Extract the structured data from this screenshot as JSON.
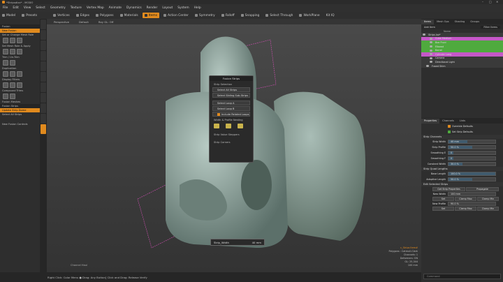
{
  "window": {
    "title": "*Stripsdlxs* - MODO",
    "min": "–",
    "max": "□",
    "close": "✕"
  },
  "menu": [
    "File",
    "Edit",
    "View",
    "Select",
    "Geometry",
    "Texture",
    "Vertex Map",
    "Animate",
    "Dynamics",
    "Render",
    "Layout",
    "System",
    "Help"
  ],
  "toolbar": {
    "model": "Model",
    "presets": "Presets",
    "vertices": "Vertices",
    "edges": "Edges",
    "polygons": "Polygons",
    "materials": "Materials",
    "items": "Items",
    "action_center": "Action Center",
    "symmetry": "Symmetry",
    "falloff": "Falloff",
    "snapping": "Snapping",
    "select_through": "Select Through",
    "workplane": "WorkPlane",
    "kit": "Kit IQ"
  },
  "left": {
    "fusion": "Fusion",
    "new_fusion": "New Fusion",
    "set_mesh_role": "Set or Change Mesh Role",
    "set_mesh_role_apply": "Set Mesh Role & Apply",
    "trim": "Trim / Un-Trim",
    "duplication": "Duplication",
    "display_filters": "Display Filters",
    "compound_trims": "Compound Trims",
    "fusion_meshes": "Fusion Meshes",
    "fusion_strips": "Fusion Strips",
    "update_strip": "Update Strip Dome",
    "select_all_strips": "Select All Strips",
    "new_fusion_controls": "New Fusion Controls"
  },
  "viewport": {
    "view": "Perspective",
    "shading": "Default",
    "ray_gl": "Ray GL: Off",
    "channel_haul": "Channel Haul"
  },
  "popup": {
    "title": "Fusion Strips",
    "strip_selection": "Strip Selection",
    "select_all": "Select All Strips",
    "select_sliding": "Select Sliding Sub-Strips",
    "select_loop_a": "Select Loop A",
    "select_loop_b": "Select Loop B",
    "include_loops": "Include Related Loops",
    "width_profile": "Width & Profile Nesting",
    "strip_value": "Strip Value Steppers",
    "strip_corners": "Strip Corners"
  },
  "strip_width": {
    "label": "Strip_Width",
    "value": "40 mm"
  },
  "vpinfo": [
    "c_Strips Item#",
    "Polygons : Catmull-Clark",
    "Channels: 1",
    "Deformers: ON",
    "GL: 25,344",
    "100 mm"
  ],
  "status": "Right Click: Color Menu  ●  Drag: Any Button] Click and Drag: Release Verify",
  "right": {
    "tabs": [
      "Items",
      "Mesh Ops",
      "Shading",
      "Groups"
    ],
    "add_item": "Add Item",
    "filter": "Filter Items",
    "name_hdr": "Name",
    "items": [
      {
        "name": "Strips.lxo*",
        "color": "#3a3a3a",
        "indent": 0
      },
      {
        "name": "Cube Medium",
        "color": "#c558c8",
        "indent": 2
      },
      {
        "name": "Box Fluid",
        "color": "#4faa3e",
        "indent": 2
      },
      {
        "name": "Elbowd",
        "color": "#4faa3e",
        "indent": 2
      },
      {
        "name": "Barrel",
        "color": "#4faa3e",
        "indent": 2
      },
      {
        "name": "Cylinder Long",
        "color": "#c558c8",
        "indent": 2
      },
      {
        "name": "Camera",
        "color": "#3a3a3a",
        "indent": 2
      },
      {
        "name": "Directional Light",
        "color": "#3a3a3a",
        "indent": 2
      },
      {
        "name": "Fused Shim",
        "color": "#3a3a3a",
        "indent": 1
      }
    ]
  },
  "props": {
    "tabs": [
      "Properties",
      "Channels",
      "Lists"
    ],
    "override": "Override Defaults",
    "set_strip_defaults": "Set Strip Defaults",
    "strip_channels": "Strip Channels",
    "rows": [
      {
        "label": "Strip Width",
        "value": "40 mm",
        "fill": 0.4
      },
      {
        "label": "Strip Profile",
        "value": "50.0 %",
        "fill": 0.5
      },
      {
        "label": "Smoothing E",
        "value": "0",
        "fill": 0.1
      },
      {
        "label": "Smoothing F",
        "value": "0",
        "fill": 0.1
      },
      {
        "label": "Constant Width",
        "value": "30.0 %",
        "fill": 0.3
      }
    ],
    "quad_lengths": "Strip Quad Lengths",
    "rows2": [
      {
        "label": "Base Length",
        "value": "100.0 %",
        "fill": 1.0
      },
      {
        "label": "Adaptive Length",
        "value": "50.0 %",
        "fill": 0.5
      }
    ],
    "edit_selected": "Edit Selected Strips",
    "get_strip": "Get Strip Properties",
    "propagate": "Propagate",
    "new_width_lbl": "New Width",
    "new_width": "100 mm",
    "new_profile_lbl": "New Profile",
    "new_profile": "90.0 %",
    "set": "Set",
    "clamp_max": "Clamp Max",
    "clamp_min": "Clamp Min"
  },
  "search": "Command",
  "colors": {
    "accent": "#e08a1e",
    "mesh": "#8fa8a0",
    "pink": "#d24fb4"
  }
}
